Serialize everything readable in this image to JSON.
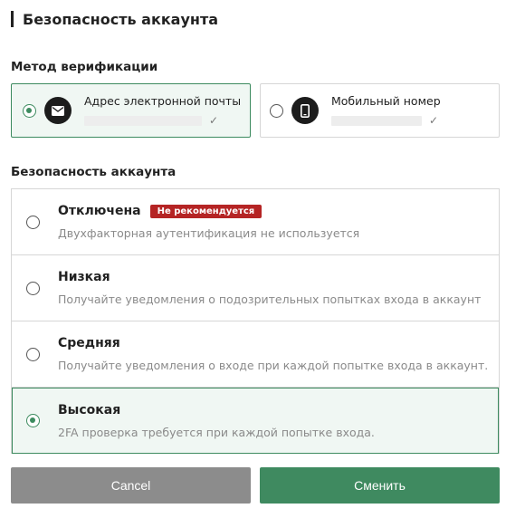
{
  "header": {
    "title": "Безопасность аккаунта"
  },
  "verification": {
    "label": "Метод верификации",
    "methods": [
      {
        "label": "Адрес электронной почты",
        "icon": "mail-icon",
        "selected": true,
        "verified": true,
        "check": "✓"
      },
      {
        "label": "Мобильный номер",
        "icon": "mobile-phone-icon",
        "selected": false,
        "verified": true,
        "check": "✓"
      }
    ]
  },
  "security": {
    "label": "Безопасность аккаунта",
    "levels": [
      {
        "title": "Отключена",
        "badge": "Не рекомендуется",
        "description": "Двухфакторная аутентификация не используется",
        "selected": false
      },
      {
        "title": "Низкая",
        "description": "Получайте уведомления о подозрительных попытках входа в аккаунт",
        "selected": false
      },
      {
        "title": "Средняя",
        "description": "Получайте уведомления о входе при каждой попытке входа в аккаунт.",
        "selected": false
      },
      {
        "title": "Высокая",
        "description": "2FA проверка требуется при каждой попытке входа.",
        "selected": true
      }
    ]
  },
  "actions": {
    "cancel_label": "Cancel",
    "submit_label": "Сменить"
  },
  "colors": {
    "accent": "#3f8a60",
    "badge": "#b52424",
    "cancel": "#8c8c8c",
    "selected_bg": "#f0f7f3"
  }
}
